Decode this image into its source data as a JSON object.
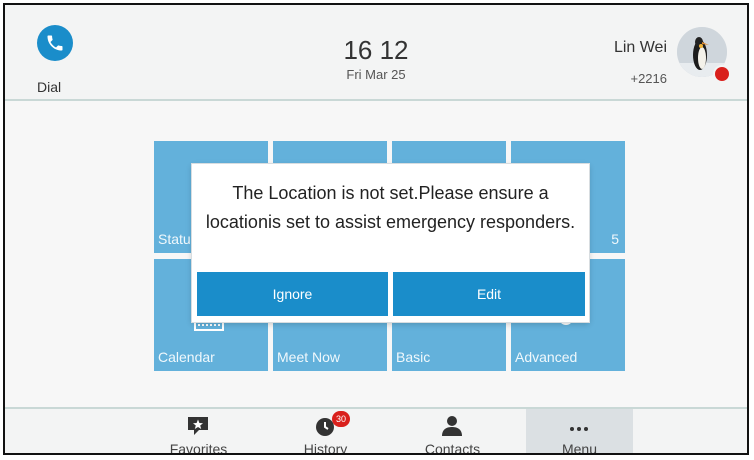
{
  "header": {
    "dial_label": "Dial",
    "time": "16 12",
    "date": "Fri Mar 25",
    "user_name": "Lin Wei",
    "user_extension": "+2216"
  },
  "tiles": [
    {
      "label": "Status",
      "number": ""
    },
    {
      "label": "",
      "number": ""
    },
    {
      "label": "",
      "number": ""
    },
    {
      "label": "",
      "number": "5"
    },
    {
      "label": "Calendar",
      "number": ""
    },
    {
      "label": "Meet Now",
      "number": ""
    },
    {
      "label": "Basic",
      "number": ""
    },
    {
      "label": "Advanced",
      "number": ""
    }
  ],
  "dialog": {
    "message": "The Location is not set.Please ensure a locationis set to assist emergency responders.",
    "ignore_label": "Ignore",
    "edit_label": "Edit"
  },
  "softkeys": [
    {
      "label": "Favorites",
      "icon": "favorites-icon"
    },
    {
      "label": "History",
      "icon": "history-icon",
      "badge": "30"
    },
    {
      "label": "Contacts",
      "icon": "contacts-icon"
    },
    {
      "label": "Menu",
      "icon": "more-icon",
      "active": true
    }
  ],
  "colors": {
    "accent": "#1a8dca",
    "background": "#f3f4f4",
    "badge": "#d9201c"
  }
}
